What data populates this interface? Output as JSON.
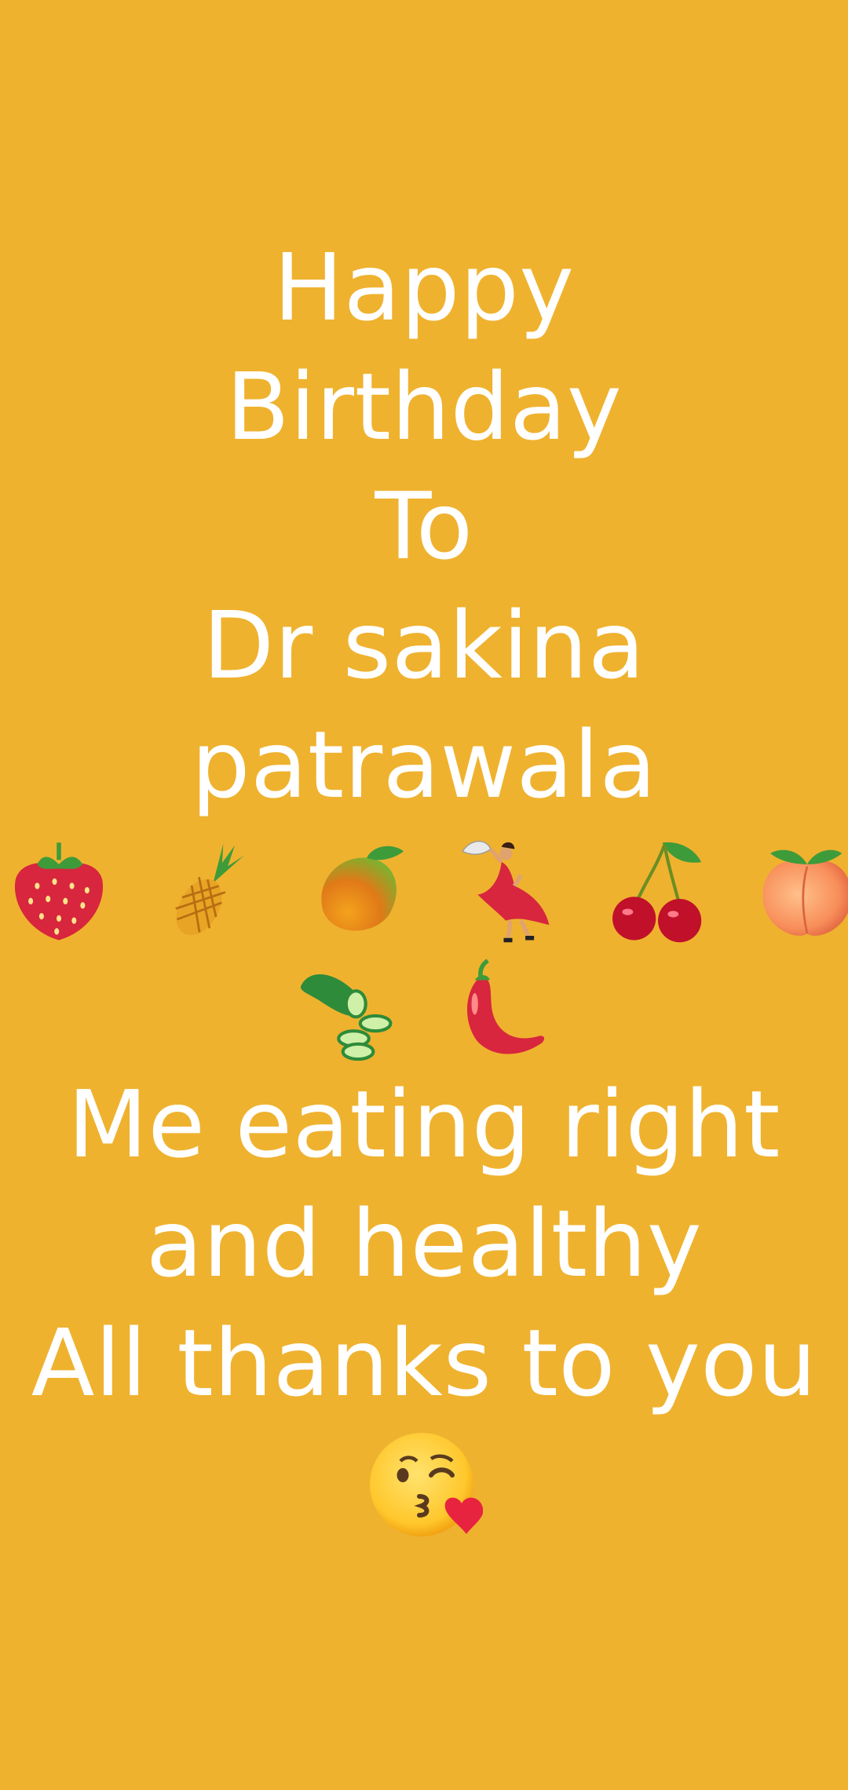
{
  "background_color": "#EFB22F",
  "text_color": "#FFFFFF",
  "status_message": {
    "lines": [
      "Happy",
      "Birthday",
      "To",
      "Dr sakina",
      "patrawala"
    ],
    "emoji_row_1": [
      "strawberry-icon",
      "pineapple-icon",
      "mango-icon",
      "dancer-icon",
      "cherries-icon",
      "peach-icon"
    ],
    "emoji_row_2": [
      "cucumber-icon",
      "chili-pepper-icon"
    ],
    "closing_lines": [
      "Me eating right",
      "and healthy",
      "All thanks to you"
    ],
    "closing_emoji": "face-blowing-kiss-icon"
  }
}
